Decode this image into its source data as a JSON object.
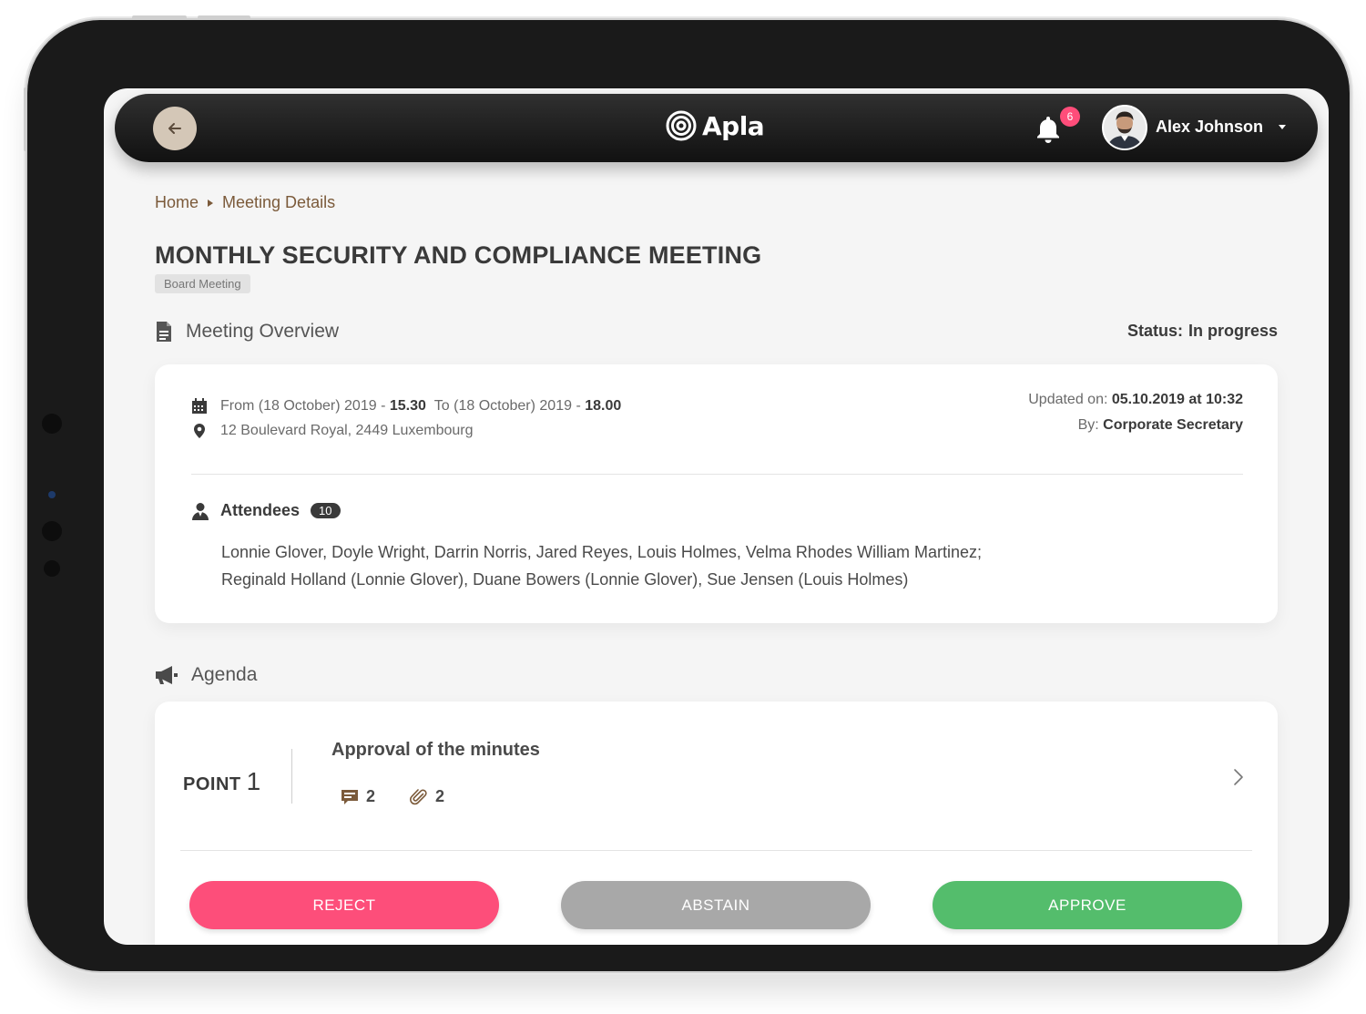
{
  "header": {
    "app_name": "Apla",
    "notification_count": "6",
    "user_name": "Alex Johnson"
  },
  "breadcrumb": {
    "home": "Home",
    "current": "Meeting Details"
  },
  "meeting": {
    "title": "MONTHLY SECURITY AND COMPLIANCE MEETING",
    "type_tag": "Board Meeting"
  },
  "overview": {
    "section_title": "Meeting Overview",
    "status_label": "Status:",
    "status_value": "In progress",
    "from_text": "From (18 October) 2019 -",
    "from_time": "15.30",
    "to_text": "To (18 October) 2019 -",
    "to_time": "18.00",
    "location": "12 Boulevard Royal, 2449 Luxembourg",
    "updated_label": "Updated on:",
    "updated_value": "05.10.2019 at 10:32",
    "by_label": "By:",
    "by_value": "Corporate Secretary",
    "attendees_label": "Attendees",
    "attendees_count": "10",
    "attendees_line1": "Lonnie Glover,  Doyle Wright,  Darrin Norris,  Jared Reyes,  Louis Holmes,   Velma Rhodes  William Martinez;",
    "attendees_line2": "Reginald Holland (Lonnie Glover),  Duane Bowers (Lonnie Glover),  Sue Jensen (Louis Holmes)"
  },
  "agenda": {
    "section_title": "Agenda",
    "point_label": "POINT",
    "point_number": "1",
    "point_title": "Approval of the minutes",
    "comments_count": "2",
    "attachments_count": "2",
    "reject_label": "REJECT",
    "abstain_label": "ABSTAIN",
    "approve_label": "APPROVE"
  },
  "colors": {
    "accent_brown": "#7b5a3a",
    "reject": "#fd4e7a",
    "abstain": "#a8a8a8",
    "approve": "#54bd6c",
    "badge": "#ff4d7a"
  },
  "icons": [
    "back-arrow-icon",
    "apla-logo-icon",
    "bell-icon",
    "document-icon",
    "calendar-icon",
    "location-pin-icon",
    "user-icon",
    "megaphone-icon",
    "comment-icon",
    "paperclip-icon",
    "chevron-right-icon"
  ]
}
